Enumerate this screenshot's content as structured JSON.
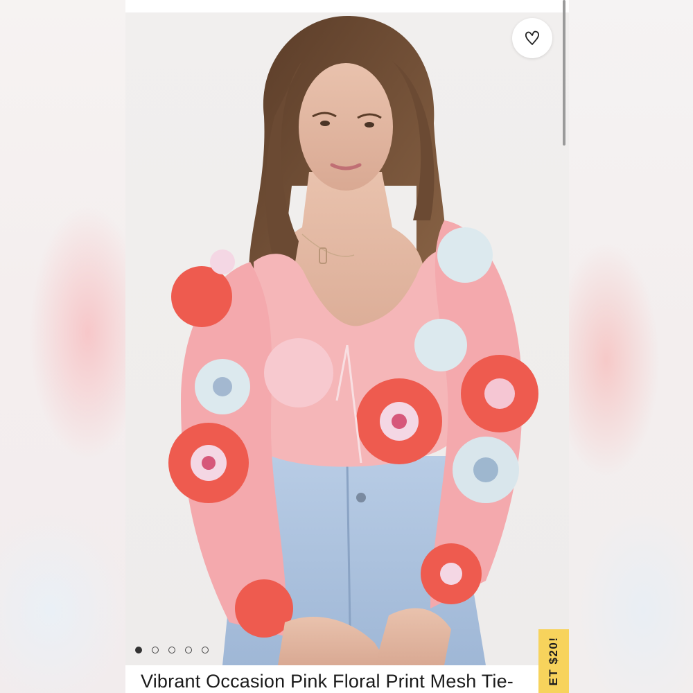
{
  "product": {
    "title": "Vibrant Occasion Pink Floral Print Mesh Tie-",
    "image_alt": "Model wearing pink floral print mesh tie-front top with light wash jeans"
  },
  "carousel": {
    "dot_count": 5,
    "active_index": 0
  },
  "wishlist": {
    "icon": "heart-icon"
  },
  "promo": {
    "label": "ET $20!"
  },
  "colors": {
    "promo_bg": "#f7d35c",
    "top_pink": "#f4a6ad",
    "flower_red": "#ee5b4f",
    "denim": "#a9c1de"
  }
}
